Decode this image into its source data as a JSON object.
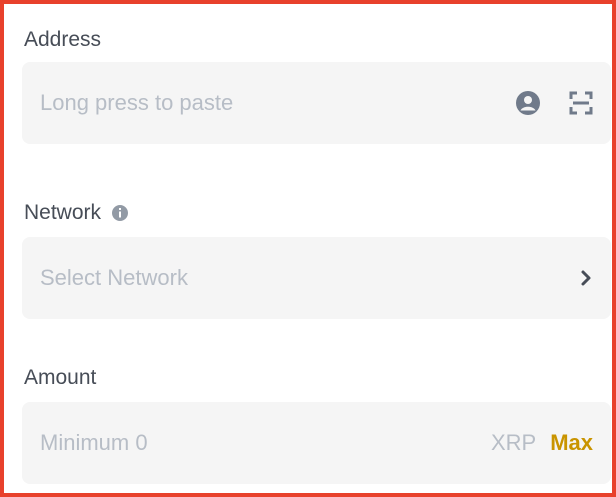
{
  "address": {
    "label": "Address",
    "placeholder": "Long press to paste",
    "icons": [
      "contact-book-icon",
      "scan-qr-icon"
    ]
  },
  "network": {
    "label": "Network",
    "placeholder": "Select Network",
    "icons": [
      "info-icon",
      "chevron-right-icon"
    ]
  },
  "amount": {
    "label": "Amount",
    "placeholder": "Minimum 0",
    "unit": "XRP",
    "max_label": "Max"
  },
  "colors": {
    "border_accent": "#e8412c",
    "max_accent": "#c99400",
    "field_bg": "#f5f5f5",
    "label_text": "#474d57",
    "placeholder_text": "#b7bdc6"
  }
}
